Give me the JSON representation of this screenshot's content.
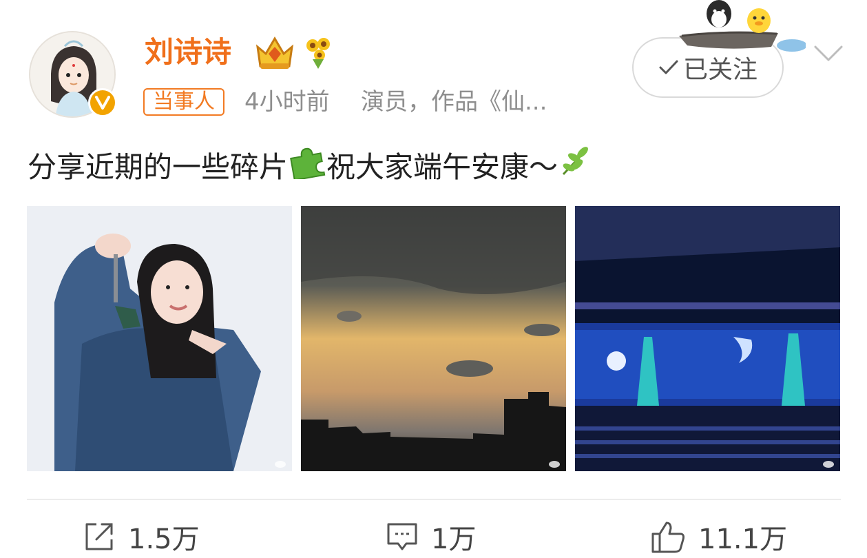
{
  "header": {
    "username": "刘诗诗",
    "tag": "当事人",
    "time": "4小时前",
    "description": "演员，作品《仙...",
    "follow_label": "已关注"
  },
  "post": {
    "text_part1": "分享近期的一些碎片",
    "text_part2": "祝大家端午安康～",
    "images": [
      {
        "icon": "portrait-photo"
      },
      {
        "icon": "sunset-sky-photo"
      },
      {
        "icon": "concert-stage-photo"
      }
    ]
  },
  "actions": {
    "share_count": "1.5万",
    "comment_count": "1万",
    "like_count": "11.1万"
  },
  "colors": {
    "username": "#f06f1a",
    "tag": "#f27a22",
    "meta": "#8e8e8e",
    "verified": "#f2a300"
  }
}
